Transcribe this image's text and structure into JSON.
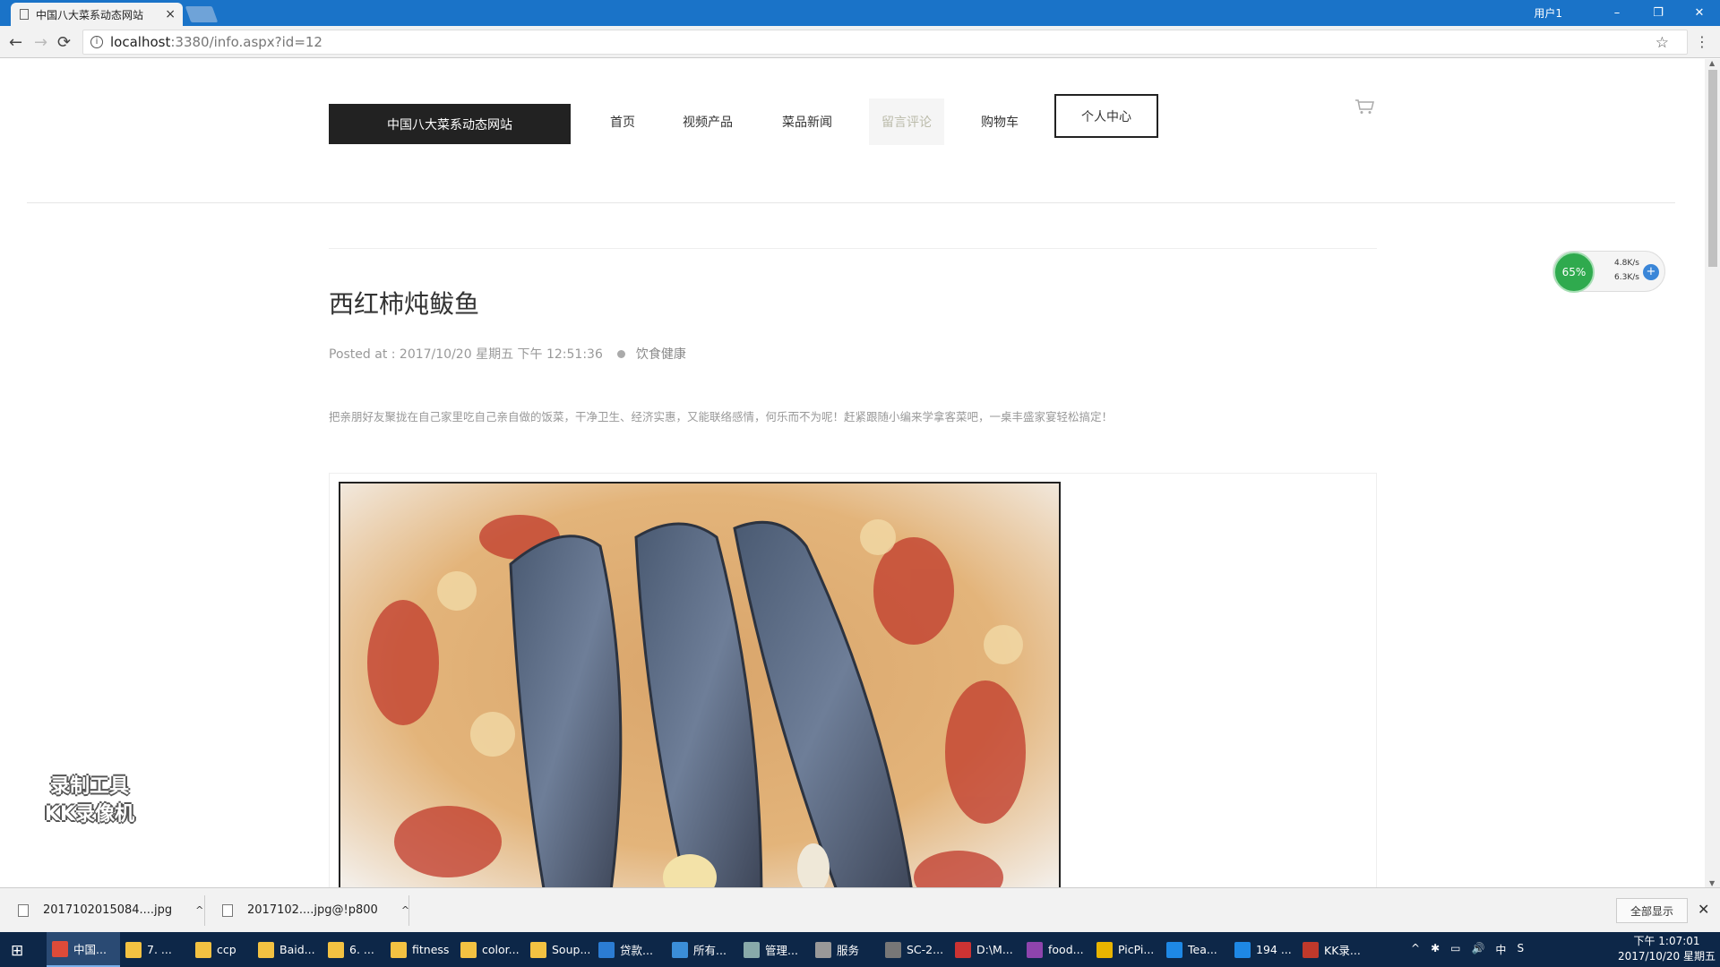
{
  "browser": {
    "tab_title": "中国八大菜系动态网站",
    "tab_close": "×",
    "user_label": "用户1",
    "window_buttons": [
      "–",
      "❐",
      "✕"
    ],
    "address_host": "localhost",
    "address_path": ":3380/info.aspx?id=12",
    "nav_back": "←",
    "nav_forward": "→",
    "nav_reload": "⟳",
    "star": "☆",
    "menu": "⋮"
  },
  "site": {
    "logo": "中国八大菜系动态网站",
    "nav": [
      {
        "label": "首页"
      },
      {
        "label": "视频产品"
      },
      {
        "label": "菜品新闻"
      },
      {
        "label": "留言评论"
      },
      {
        "label": "购物车"
      }
    ],
    "personal_center": "个人中心"
  },
  "article": {
    "title": "西红柿炖鲅鱼",
    "posted_at": "Posted at : 2017/10/20 星期五 下午 12:51:36",
    "category": "饮食健康",
    "summary": "把亲朋好友聚拢在自己家里吃自己亲自做的饭菜，干净卫生、经济实惠，又能联络感情，何乐而不为呢！赶紧跟随小编来学拿客菜吧，一桌丰盛家宴轻松搞定！"
  },
  "overlays": {
    "watermark_lines": [
      "录制工具",
      "KK录像机"
    ],
    "net_percent": "65%",
    "net_up": "4.8K/s",
    "net_down": "6.3K/s",
    "net_plus": "+"
  },
  "downloads": {
    "items": [
      {
        "name": "2017102015084....jpg"
      },
      {
        "name": "2017102....jpg@!p800"
      }
    ],
    "show_all": "全部显示",
    "close": "✕",
    "chevron": "^"
  },
  "taskbar": {
    "start": "⊞",
    "items": [
      {
        "label": "中国...",
        "color": "#dd4b39"
      },
      {
        "label": "7. ...",
        "color": "#f3c242"
      },
      {
        "label": "ccp",
        "color": "#f3c242"
      },
      {
        "label": "Baid...",
        "color": "#f3c242"
      },
      {
        "label": "6. ...",
        "color": "#f3c242"
      },
      {
        "label": "fitness",
        "color": "#f3c242"
      },
      {
        "label": "color...",
        "color": "#f3c242"
      },
      {
        "label": "Soup...",
        "color": "#f3c242"
      },
      {
        "label": "贷款...",
        "color": "#2b7cd3"
      },
      {
        "label": "所有...",
        "color": "#3b8ed8"
      },
      {
        "label": "管理...",
        "color": "#8aa"
      },
      {
        "label": "服务",
        "color": "#999"
      },
      {
        "label": "SC-2...",
        "color": "#777"
      },
      {
        "label": "D:\\M...",
        "color": "#c33"
      },
      {
        "label": "food...",
        "color": "#8e44ad"
      },
      {
        "label": "PicPi...",
        "color": "#e8b400"
      },
      {
        "label": "Tea...",
        "color": "#1e88e5"
      },
      {
        "label": "194 ...",
        "color": "#1e88e5"
      },
      {
        "label": "KK录...",
        "color": "#c0392b"
      }
    ],
    "tray": [
      "^",
      "✱",
      "▭",
      "🔊",
      "中",
      "S"
    ],
    "time": "下午 1:07:01",
    "date": "2017/10/20 星期五"
  }
}
